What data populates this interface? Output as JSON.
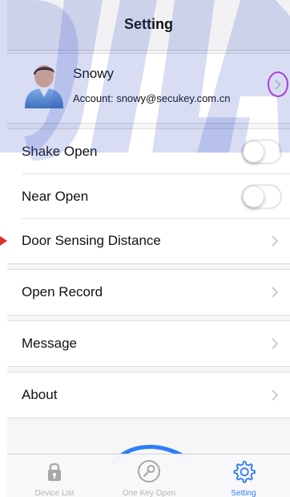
{
  "nav": {
    "title": "Setting"
  },
  "account": {
    "name": "Snowy",
    "account_text": "Account: snowy@secukey.com.cn"
  },
  "settings_group": {
    "shake_open": {
      "label": "Shake Open",
      "enabled": false
    },
    "near_open": {
      "label": "Near Open",
      "enabled": false
    },
    "door_sensing": {
      "label": "Door Sensing Distance"
    }
  },
  "open_record": {
    "label": "Open Record"
  },
  "message": {
    "label": "Message"
  },
  "about": {
    "label": "About"
  },
  "tabbar": {
    "tabs": [
      {
        "label": "Device List",
        "icon": "lock-icon"
      },
      {
        "label": "One Key Open",
        "icon": "key-icon"
      },
      {
        "label": "Setting",
        "icon": "gear-icon",
        "active": true
      }
    ]
  },
  "colors": {
    "accent": "#2d7cf6",
    "highlight_ring": "#c53bd8",
    "watermark": "#3b56c8",
    "pointer": "#e0302b"
  }
}
